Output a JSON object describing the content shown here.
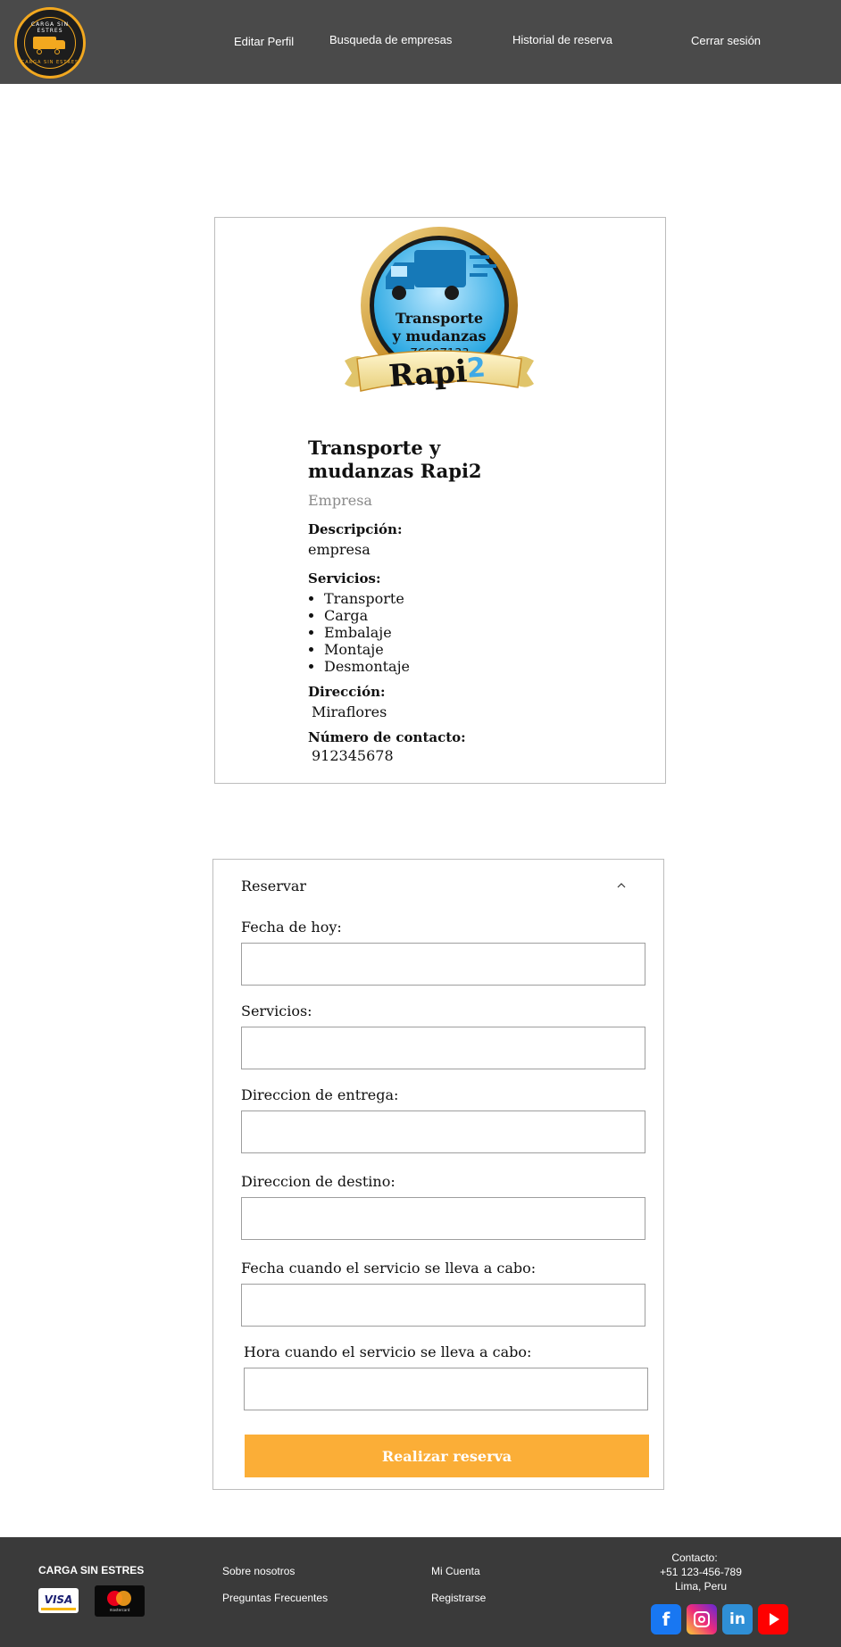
{
  "header": {
    "logo": {
      "text_top": "CARGA SIN ESTRES",
      "text_bottom": "CARGA SIN ESTRES",
      "icon": "truck-icon"
    },
    "nav": {
      "edit_profile": "Editar Perfil",
      "company_search": "Busqueda de empresas",
      "booking_history": "Historial de reserva",
      "logout": "Cerrar sesión"
    },
    "background_color": "#4a4a4a"
  },
  "profile": {
    "badge": {
      "line1": "Transporte",
      "line2": "y mudanzas",
      "phone": "76697133",
      "ribbon_text": "Rapi",
      "ribbon_number": "2",
      "icon": "fast-truck-icon"
    },
    "name": "Transporte y mudanzas Rapi2",
    "type": "Empresa",
    "description_label": "Descripción:",
    "description": "empresa",
    "services_label": "Servicios:",
    "services": [
      "Transporte",
      "Carga",
      "Embalaje",
      "Montaje",
      "Desmontaje"
    ],
    "address_label": "Dirección:",
    "address": "Miraflores",
    "contact_label": "Número de contacto:",
    "contact": "912345678"
  },
  "reservation": {
    "title": "Reservar",
    "expanded": true,
    "fields": [
      {
        "label": "Fecha de hoy:",
        "value": ""
      },
      {
        "label": "Servicios:",
        "value": ""
      },
      {
        "label": "Direccion de entrega:",
        "value": ""
      },
      {
        "label": "Direccion de destino:",
        "value": ""
      },
      {
        "label": "Fecha cuando el servicio se lleva a cabo:",
        "value": ""
      },
      {
        "label": "Hora cuando el servicio se lleva a cabo:",
        "value": ""
      }
    ],
    "submit_label": "Realizar reserva",
    "submit_color": "#fbae37"
  },
  "footer": {
    "brand": "CARGA SIN ESTRES",
    "payments": {
      "visa": "VISA",
      "mastercard": "mastercard"
    },
    "links_col1": [
      "Sobre nosotros",
      "Preguntas Frecuentes"
    ],
    "links_col2": [
      "Mi Cuenta",
      "Registrarse"
    ],
    "contact_title": "Contacto:",
    "contact_phone": "+51 123-456-789",
    "contact_city": "Lima, Peru",
    "social": [
      "facebook-icon",
      "instagram-icon",
      "linkedin-icon",
      "youtube-icon"
    ],
    "background_color": "#3a3a3a"
  }
}
